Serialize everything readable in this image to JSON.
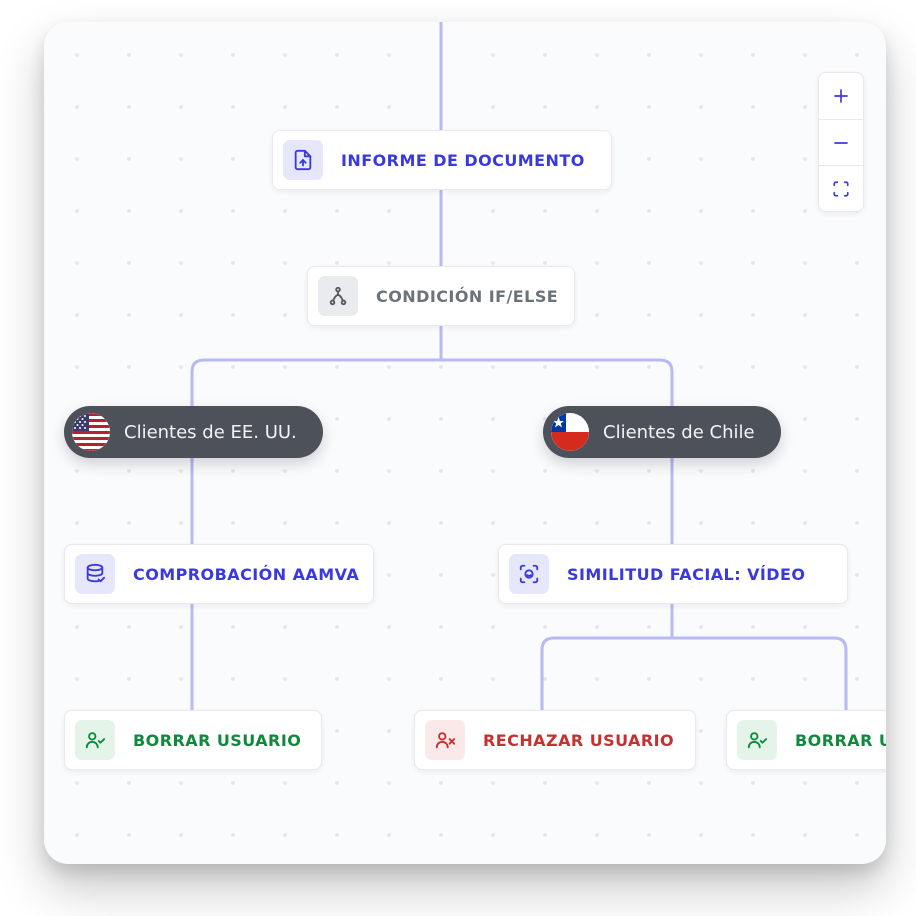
{
  "nodes": {
    "document_report": {
      "label": "INFORME DE DOCUMENTO"
    },
    "condition": {
      "label": "CONDICIÓN IF/ELSE"
    },
    "aamva": {
      "label": "COMPROBACIÓN AAMVA"
    },
    "facial": {
      "label": "SIMILITUD FACIAL: VÍDEO"
    },
    "clear_user_left": {
      "label": "BORRAR USUARIO"
    },
    "reject_user": {
      "label": "RECHAZAR USUARIO"
    },
    "clear_user_right": {
      "label": "BORRAR USUARIO"
    }
  },
  "branches": {
    "us": {
      "label": "Clientes de EE. UU."
    },
    "chile": {
      "label": "Clientes de Chile"
    }
  },
  "controls": {
    "zoom_in": "Zoom in",
    "zoom_out": "Zoom out",
    "fit": "Fit to screen"
  }
}
